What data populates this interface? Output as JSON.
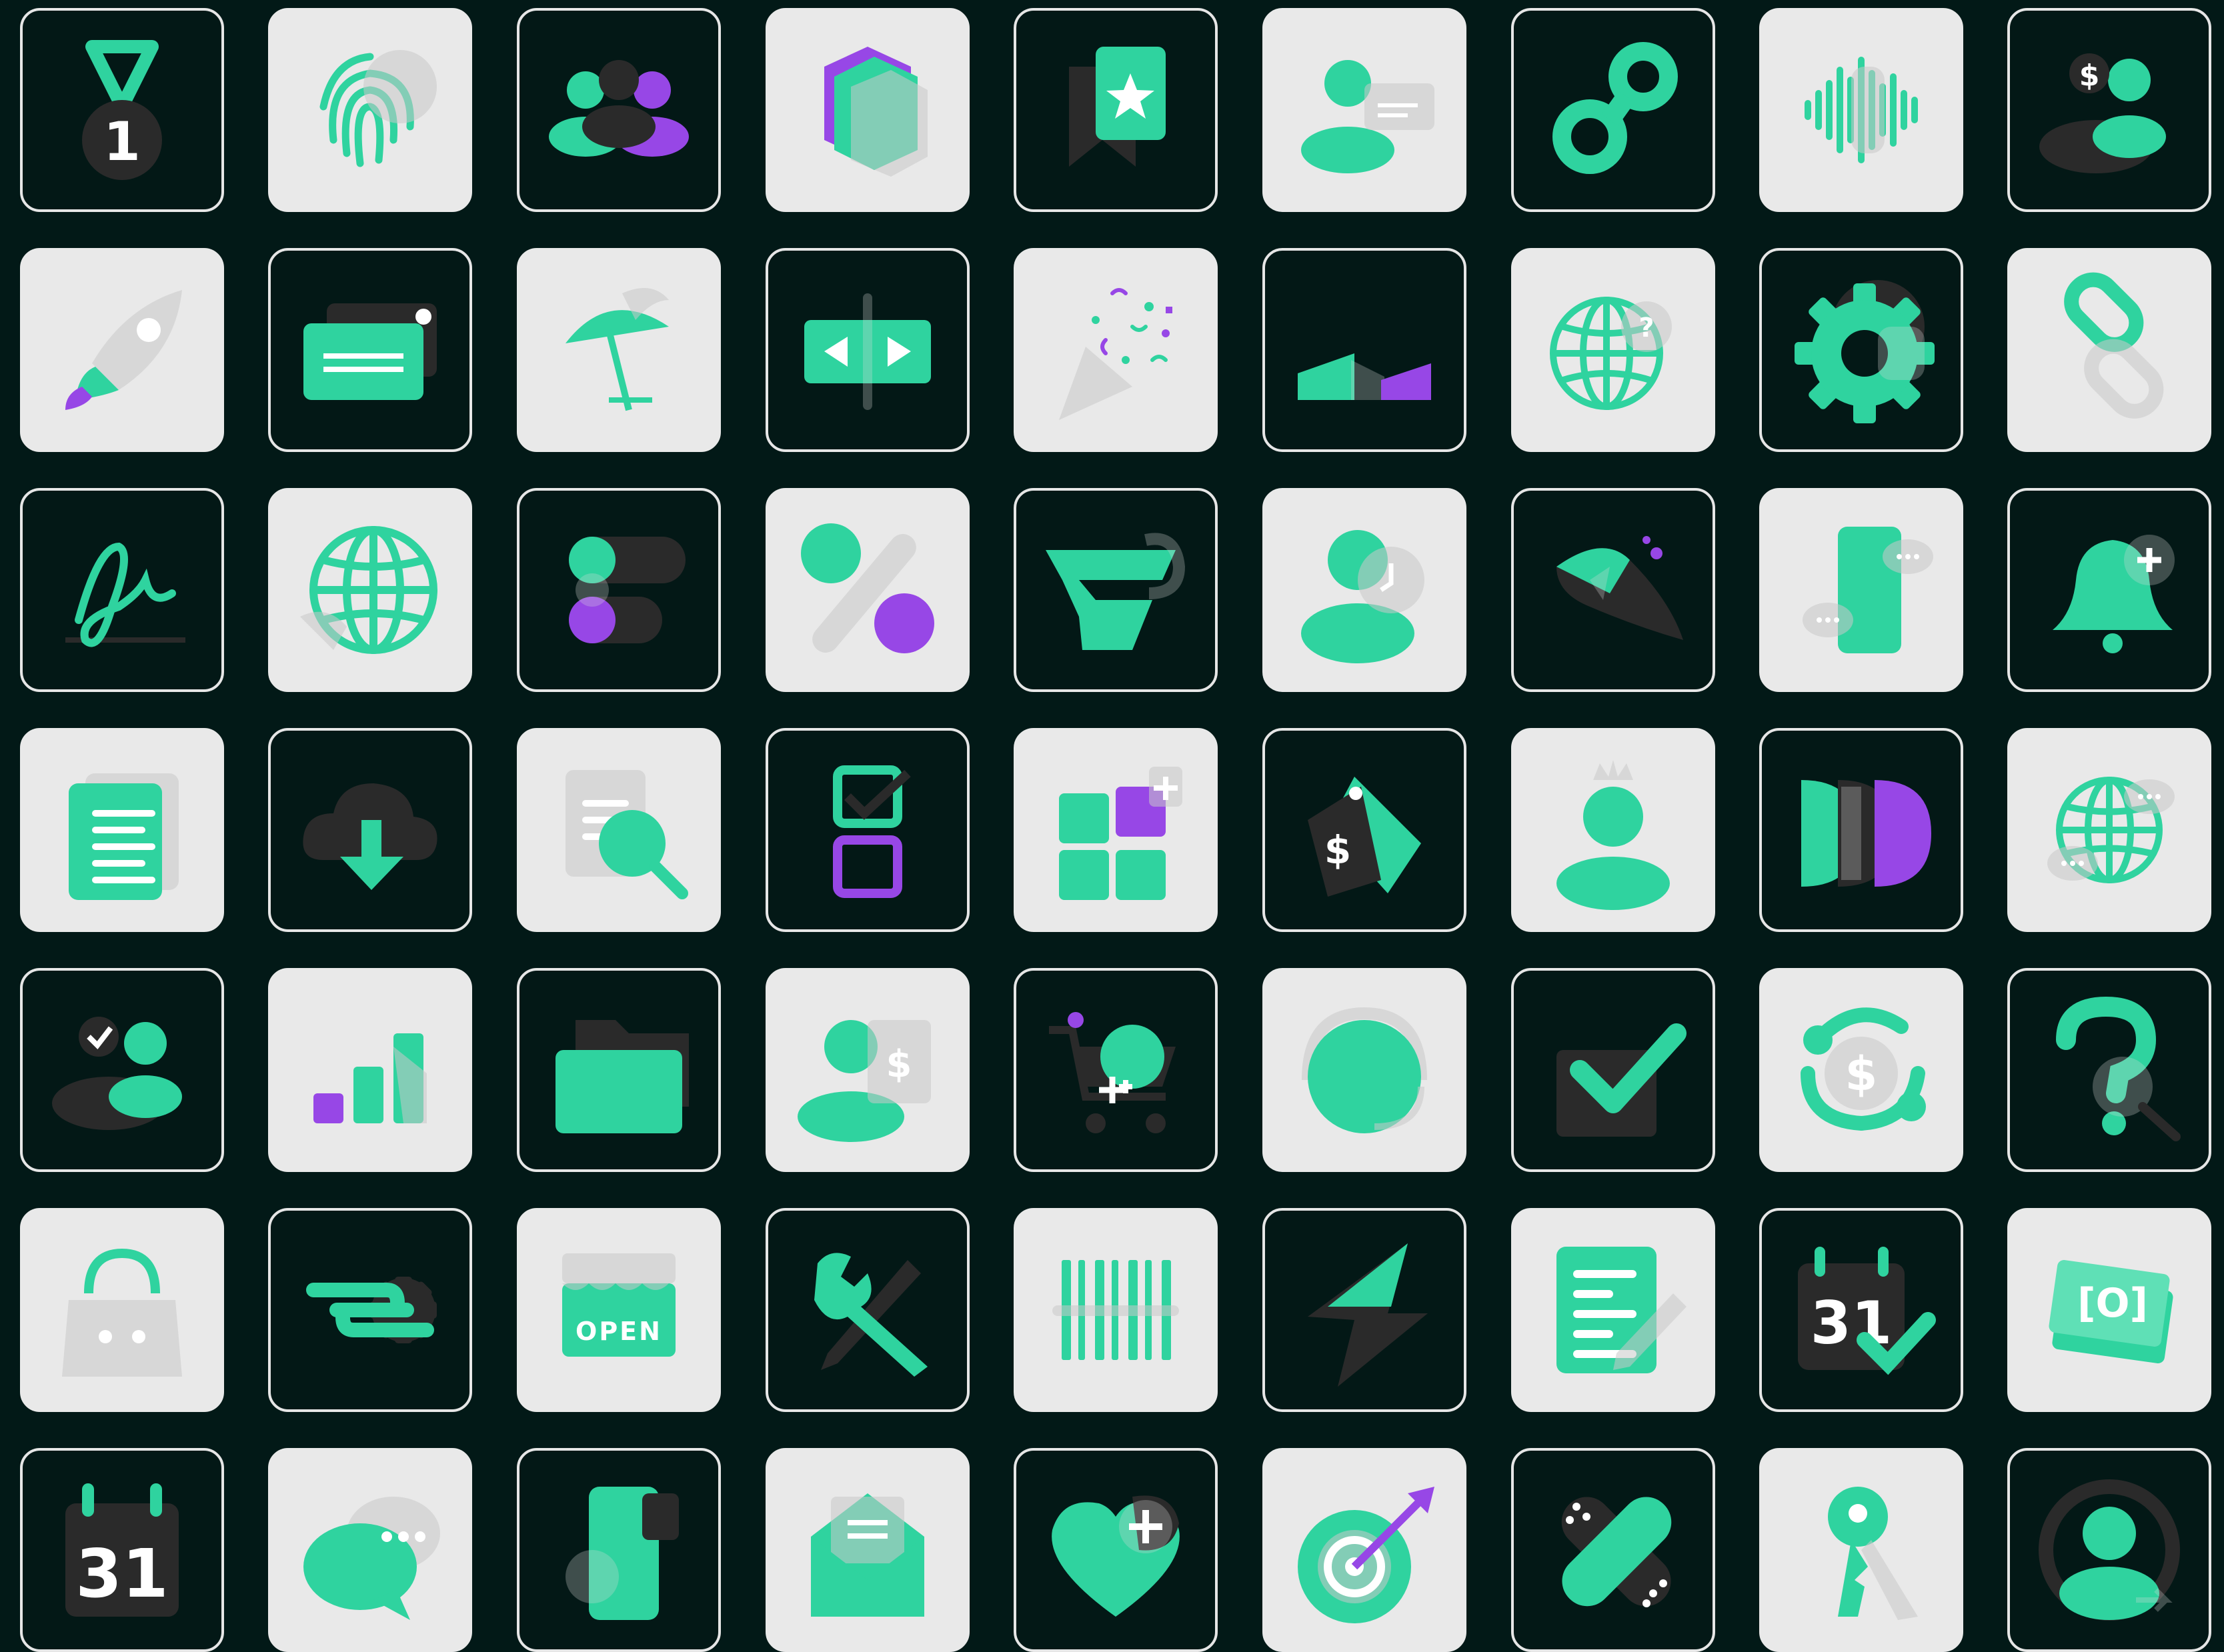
{
  "palette": {
    "accent": "#2fd39f",
    "accent_light": "#5fe0b6",
    "purple": "#9747e6",
    "dark_shape": "#2a2a2a",
    "tile_dark_bg": "#031816",
    "tile_light_bg": "#e9e9e9",
    "tile_border": "#e6e6e6",
    "page_bg": "#021917"
  },
  "tiles": [
    {
      "icon": "medal-icon",
      "variant": "dark",
      "text": "1"
    },
    {
      "icon": "fingerprint-icon",
      "variant": "light"
    },
    {
      "icon": "team-icon",
      "variant": "dark"
    },
    {
      "icon": "layers-icon",
      "variant": "light"
    },
    {
      "icon": "bookmark-star-icon",
      "variant": "dark"
    },
    {
      "icon": "user-id-card-icon",
      "variant": "light"
    },
    {
      "icon": "chain-link-icon",
      "variant": "dark"
    },
    {
      "icon": "sound-wave-icon",
      "variant": "light"
    },
    {
      "icon": "user-dollar-icon",
      "variant": "dark",
      "text": "$"
    },
    {
      "icon": "rocket-icon",
      "variant": "light"
    },
    {
      "icon": "credit-card-icon",
      "variant": "dark"
    },
    {
      "icon": "beach-umbrella-icon",
      "variant": "light"
    },
    {
      "icon": "resize-horizontal-icon",
      "variant": "dark"
    },
    {
      "icon": "party-popper-icon",
      "variant": "light"
    },
    {
      "icon": "stairs-chart-icon",
      "variant": "dark"
    },
    {
      "icon": "globe-question-icon",
      "variant": "light"
    },
    {
      "icon": "gear-icon",
      "variant": "dark"
    },
    {
      "icon": "link-icon",
      "variant": "light"
    },
    {
      "icon": "signature-icon",
      "variant": "dark"
    },
    {
      "icon": "globe-icon",
      "variant": "light"
    },
    {
      "icon": "toggle-switches-icon",
      "variant": "dark"
    },
    {
      "icon": "percent-icon",
      "variant": "light"
    },
    {
      "icon": "webflow-funnel-icon",
      "variant": "dark"
    },
    {
      "icon": "user-clock-icon",
      "variant": "light"
    },
    {
      "icon": "feather-quill-icon",
      "variant": "dark"
    },
    {
      "icon": "phone-chat-icon",
      "variant": "light"
    },
    {
      "icon": "bell-plus-icon",
      "variant": "dark"
    },
    {
      "icon": "document-icon",
      "variant": "light"
    },
    {
      "icon": "cloud-download-icon",
      "variant": "dark"
    },
    {
      "icon": "document-search-icon",
      "variant": "light"
    },
    {
      "icon": "checklist-icon",
      "variant": "dark"
    },
    {
      "icon": "apps-grid-plus-icon",
      "variant": "light"
    },
    {
      "icon": "price-tags-icon",
      "variant": "dark",
      "text": "$"
    },
    {
      "icon": "user-crown-icon",
      "variant": "light"
    },
    {
      "icon": "fast-forward-shapes-icon",
      "variant": "dark"
    },
    {
      "icon": "globe-chat-icon",
      "variant": "light"
    },
    {
      "icon": "user-check-icon",
      "variant": "dark"
    },
    {
      "icon": "bar-growth-icon",
      "variant": "light"
    },
    {
      "icon": "folder-icon",
      "variant": "dark"
    },
    {
      "icon": "user-invoice-icon",
      "variant": "light",
      "text": "$"
    },
    {
      "icon": "cart-add-icon",
      "variant": "dark"
    },
    {
      "icon": "headset-support-icon",
      "variant": "light"
    },
    {
      "icon": "checkbox-check-icon",
      "variant": "dark"
    },
    {
      "icon": "dollar-refresh-icon",
      "variant": "light",
      "text": "$"
    },
    {
      "icon": "question-search-icon",
      "variant": "dark"
    },
    {
      "icon": "shopping-bag-icon",
      "variant": "light"
    },
    {
      "icon": "settings-switch-icon",
      "variant": "dark"
    },
    {
      "icon": "open-store-icon",
      "variant": "light",
      "text": "OPEN"
    },
    {
      "icon": "tools-icon",
      "variant": "dark"
    },
    {
      "icon": "barcode-icon",
      "variant": "light"
    },
    {
      "icon": "lightning-icon",
      "variant": "dark"
    },
    {
      "icon": "document-edit-icon",
      "variant": "light"
    },
    {
      "icon": "calendar-check-icon",
      "variant": "dark",
      "text": "31"
    },
    {
      "icon": "cash-scan-icon",
      "variant": "light",
      "text": "[O]"
    },
    {
      "icon": "calendar-icon",
      "variant": "dark",
      "text": "31"
    },
    {
      "icon": "chat-bubbles-icon",
      "variant": "light"
    },
    {
      "icon": "smartphone-icon",
      "variant": "dark"
    },
    {
      "icon": "open-envelope-icon",
      "variant": "light"
    },
    {
      "icon": "heart-plus-icon",
      "variant": "dark"
    },
    {
      "icon": "target-arrow-icon",
      "variant": "light"
    },
    {
      "icon": "bandage-icon",
      "variant": "dark"
    },
    {
      "icon": "pin-key-icon",
      "variant": "light"
    },
    {
      "icon": "user-circle-icon",
      "variant": "dark"
    }
  ]
}
